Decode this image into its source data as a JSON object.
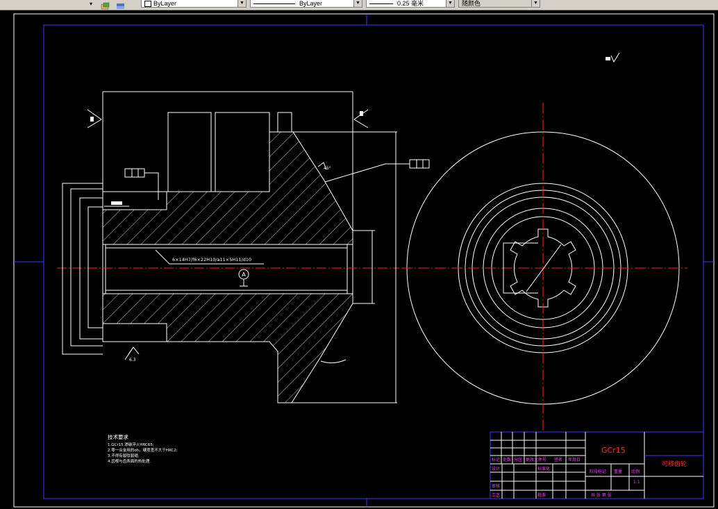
{
  "toolbar": {
    "color_combo": "ByLayer",
    "linetype_combo": "ByLayer",
    "lineweight_combo": "0.25 毫米",
    "plotstyle_combo": "随颜色"
  },
  "drawing": {
    "spline_spec": "6×14H7/f6×22H10/a11×5H11/d10",
    "datum_label": "A",
    "roughness_value": "6.3",
    "chamfer_note": "45°"
  },
  "tech_requirements": {
    "title": "技术要求",
    "items": [
      "1.GCr15 渗碳淬火HRC65;",
      "2.零一合金用的σh，硬度差不大于HRC2;",
      "3.不得有裂纹裂缝;",
      "4.齿根与齿表面的热处理."
    ]
  },
  "title_block": {
    "material": "GCr15",
    "part_name": "可移齿轮",
    "headers": [
      "标记",
      "处数",
      "分区",
      "更改文件号",
      "签名",
      "年月日"
    ],
    "row_labels": [
      "设计",
      "审核",
      "工艺"
    ],
    "mid_labels": [
      "标准化",
      "批准"
    ],
    "stage_label": "阶段标记",
    "weight_label": "重量",
    "scale_label": "比例",
    "scale_value": "1:1",
    "sheet_label": "共 张 第 张"
  }
}
